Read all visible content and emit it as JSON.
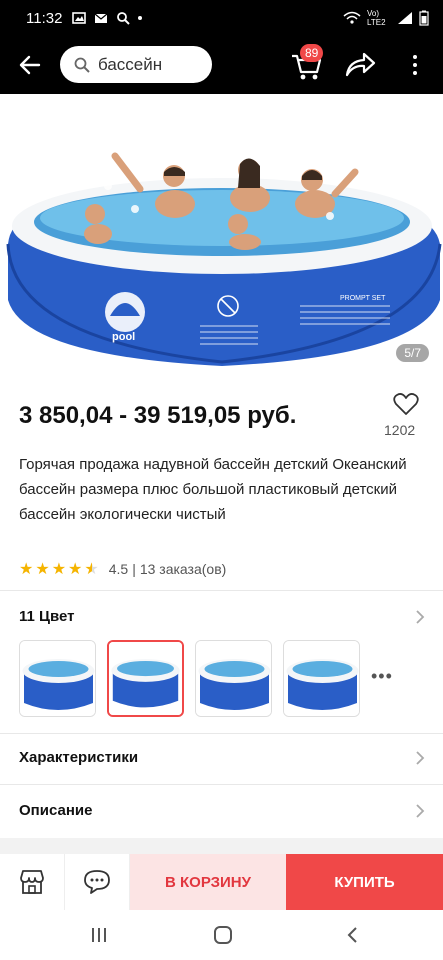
{
  "status_bar": {
    "time": "11:32",
    "network": "Vo) LTE2"
  },
  "app_bar": {
    "search_text": "бассейн",
    "cart_count": "89",
    "icons": [
      "back-arrow-icon",
      "search-icon",
      "cart-icon",
      "share-icon",
      "more-vert-icon"
    ]
  },
  "gallery": {
    "counter": "5/7"
  },
  "product": {
    "price": "3 850,04 - 39 519,05 руб.",
    "wishlist_count": "1202",
    "title": "Горячая продажа надувной бассейн детский Океанский бассейн размера плюс большой пластиковый детский бассейн экологически чистый",
    "rating": "4.5",
    "rating_value": 4.5,
    "orders": "13 заказа(ов)",
    "colors_label": "11 Цвет",
    "selected_swatch": 2
  },
  "sections": {
    "specs": "Характеристики",
    "description": "Описание"
  },
  "actions": {
    "add_to_cart": "В КОРЗИНУ",
    "buy": "КУПИТЬ"
  },
  "colors": {
    "accent": "#f04848",
    "star": "#f5b400"
  }
}
